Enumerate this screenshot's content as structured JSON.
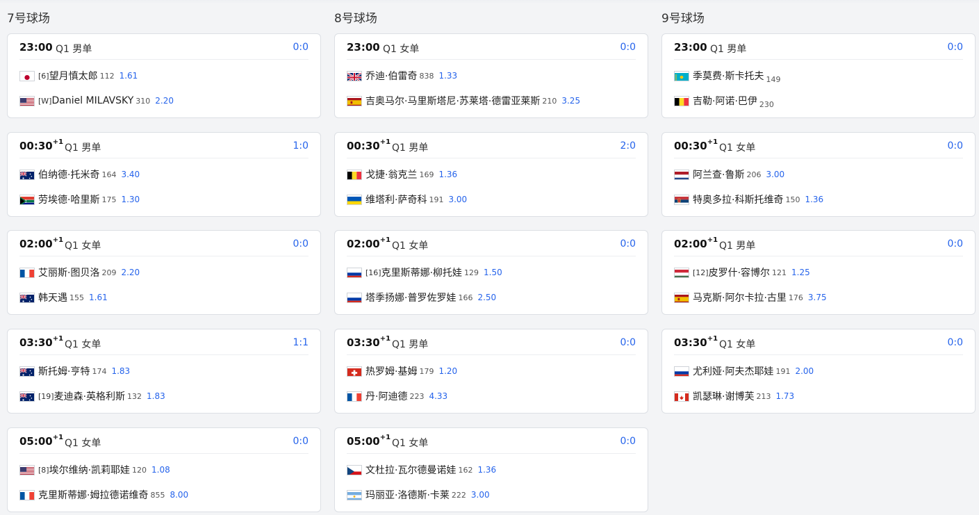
{
  "courts": [
    {
      "title": "7号球场",
      "matches": [
        {
          "time": "23:00",
          "plus": "",
          "round": "Q1 男单",
          "score": "0:0",
          "p1": {
            "flag": "jp",
            "seed": "[6]",
            "name": "望月慎太郎",
            "rank": "112",
            "odds": "1.61"
          },
          "p2": {
            "flag": "us",
            "seed": "[W]",
            "name": "Daniel MILAVSKY",
            "rank": "310",
            "odds": "2.20"
          }
        },
        {
          "time": "00:30",
          "plus": "+1",
          "round": "Q1 男单",
          "score": "1:0",
          "p1": {
            "flag": "au",
            "seed": "",
            "name": "伯纳德·托米奇",
            "rank": "164",
            "odds": "3.40"
          },
          "p2": {
            "flag": "za",
            "seed": "",
            "name": "劳埃德·哈里斯",
            "rank": "175",
            "odds": "1.30"
          }
        },
        {
          "time": "02:00",
          "plus": "+1",
          "round": "Q1 女单",
          "score": "0:0",
          "p1": {
            "flag": "fr",
            "seed": "",
            "name": "艾丽斯·图贝洛",
            "rank": "209",
            "odds": "2.20"
          },
          "p2": {
            "flag": "au",
            "seed": "",
            "name": "韩天遇",
            "rank": "155",
            "odds": "1.61"
          }
        },
        {
          "time": "03:30",
          "plus": "+1",
          "round": "Q1 女单",
          "score": "1:1",
          "p1": {
            "flag": "au",
            "seed": "",
            "name": "斯托姆·亨特",
            "rank": "174",
            "odds": "1.83"
          },
          "p2": {
            "flag": "au",
            "seed": "[19]",
            "name": "麦迪森·英格利斯",
            "rank": "132",
            "odds": "1.83"
          }
        },
        {
          "time": "05:00",
          "plus": "+1",
          "round": "Q1 女单",
          "score": "0:0",
          "p1": {
            "flag": "us",
            "seed": "[8]",
            "name": "埃尔维纳·凯莉耶娃",
            "rank": "120",
            "odds": "1.08"
          },
          "p2": {
            "flag": "fr",
            "seed": "",
            "name": "克里斯蒂娜·姆拉德诺维奇",
            "rank": "855",
            "odds": "8.00"
          }
        }
      ]
    },
    {
      "title": "8号球场",
      "matches": [
        {
          "time": "23:00",
          "plus": "",
          "round": "Q1 女单",
          "score": "0:0",
          "p1": {
            "flag": "gb",
            "seed": "",
            "name": "乔迪·伯雷奇",
            "rank": "838",
            "odds": "1.33"
          },
          "p2": {
            "flag": "es",
            "seed": "",
            "name": "吉奥马尔·马里斯塔尼·苏莱塔·德雷亚莱斯",
            "rank": "210",
            "odds": "3.25"
          }
        },
        {
          "time": "00:30",
          "plus": "+1",
          "round": "Q1 男单",
          "score": "2:0",
          "p1": {
            "flag": "be",
            "seed": "",
            "name": "戈捷·翁克兰",
            "rank": "169",
            "odds": "1.36"
          },
          "p2": {
            "flag": "ua",
            "seed": "",
            "name": "维塔利·萨奇科",
            "rank": "191",
            "odds": "3.00"
          }
        },
        {
          "time": "02:00",
          "plus": "+1",
          "round": "Q1 女单",
          "score": "0:0",
          "p1": {
            "flag": "ru",
            "seed": "[16]",
            "name": "克里斯蒂娜·柳托娃",
            "rank": "129",
            "odds": "1.50"
          },
          "p2": {
            "flag": "ru",
            "seed": "",
            "name": "塔季扬娜·普罗佐罗娃",
            "rank": "166",
            "odds": "2.50"
          }
        },
        {
          "time": "03:30",
          "plus": "+1",
          "round": "Q1 男单",
          "score": "0:0",
          "p1": {
            "flag": "ch",
            "seed": "",
            "name": "热罗姆·基姆",
            "rank": "179",
            "odds": "1.20"
          },
          "p2": {
            "flag": "fr",
            "seed": "",
            "name": "丹·阿迪德",
            "rank": "223",
            "odds": "4.33"
          }
        },
        {
          "time": "05:00",
          "plus": "+1",
          "round": "Q1 女单",
          "score": "0:0",
          "p1": {
            "flag": "cz",
            "seed": "",
            "name": "文杜拉·瓦尔德曼诺娃",
            "rank": "162",
            "odds": "1.36"
          },
          "p2": {
            "flag": "ar",
            "seed": "",
            "name": "玛丽亚·洛德斯·卡莱",
            "rank": "222",
            "odds": "3.00"
          }
        }
      ]
    },
    {
      "title": "9号球场",
      "matches": [
        {
          "time": "23:00",
          "plus": "",
          "round": "Q1 男单",
          "score": "0:0",
          "p1": {
            "flag": "kz",
            "seed": "",
            "name": "季莫费·斯卡托夫",
            "rank": "149",
            "odds": "",
            "rank_sub": true
          },
          "p2": {
            "flag": "be",
            "seed": "",
            "name": "吉勒·阿诺·巴伊",
            "rank": "230",
            "odds": "",
            "rank_sub": true
          }
        },
        {
          "time": "00:30",
          "plus": "+1",
          "round": "Q1 女单",
          "score": "0:0",
          "p1": {
            "flag": "nl",
            "seed": "",
            "name": "阿兰查·鲁斯",
            "rank": "206",
            "odds": "3.00"
          },
          "p2": {
            "flag": "rs",
            "seed": "",
            "name": "特奥多拉·科斯托维奇",
            "rank": "150",
            "odds": "1.36"
          }
        },
        {
          "time": "02:00",
          "plus": "+1",
          "round": "Q1 男单",
          "score": "0:0",
          "p1": {
            "flag": "hu",
            "seed": "[12]",
            "name": "皮罗什·容博尔",
            "rank": "121",
            "odds": "1.25"
          },
          "p2": {
            "flag": "es",
            "seed": "",
            "name": "马克斯·阿尔卡拉·古里",
            "rank": "176",
            "odds": "3.75"
          }
        },
        {
          "time": "03:30",
          "plus": "+1",
          "round": "Q1 女单",
          "score": "0:0",
          "p1": {
            "flag": "ru",
            "seed": "",
            "name": "尤利娅·阿夫杰耶娃",
            "rank": "191",
            "odds": "2.00"
          },
          "p2": {
            "flag": "ca",
            "seed": "",
            "name": "凯瑟琳·谢博芙",
            "rank": "213",
            "odds": "1.73"
          }
        }
      ]
    }
  ]
}
